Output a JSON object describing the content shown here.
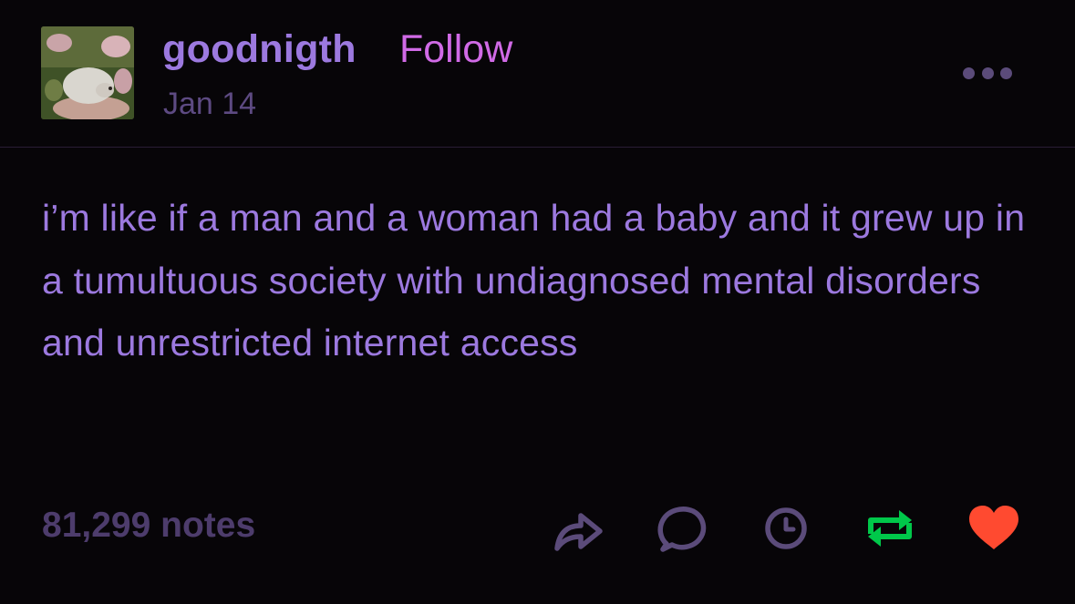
{
  "post": {
    "username": "goodnigth",
    "follow_label": "Follow",
    "date": "Jan 14",
    "body": "i’m like if a man and a woman had a baby and it grew up in a tumultuous society with undiagnosed mental disorders and unrestricted internet access",
    "notes": "81,299 notes"
  },
  "icons": {
    "more": "more-options-icon",
    "share": "share-icon",
    "reply": "reply-icon",
    "queue": "clock-icon",
    "reblog": "reblog-icon",
    "like": "heart-icon"
  },
  "colors": {
    "background": "#070508",
    "text": "#9c79df",
    "follow": "#d06ae6",
    "muted": "#5d4a82",
    "icon": "#5b4b7a",
    "reblog": "#00c84a",
    "like": "#ff4a30"
  }
}
